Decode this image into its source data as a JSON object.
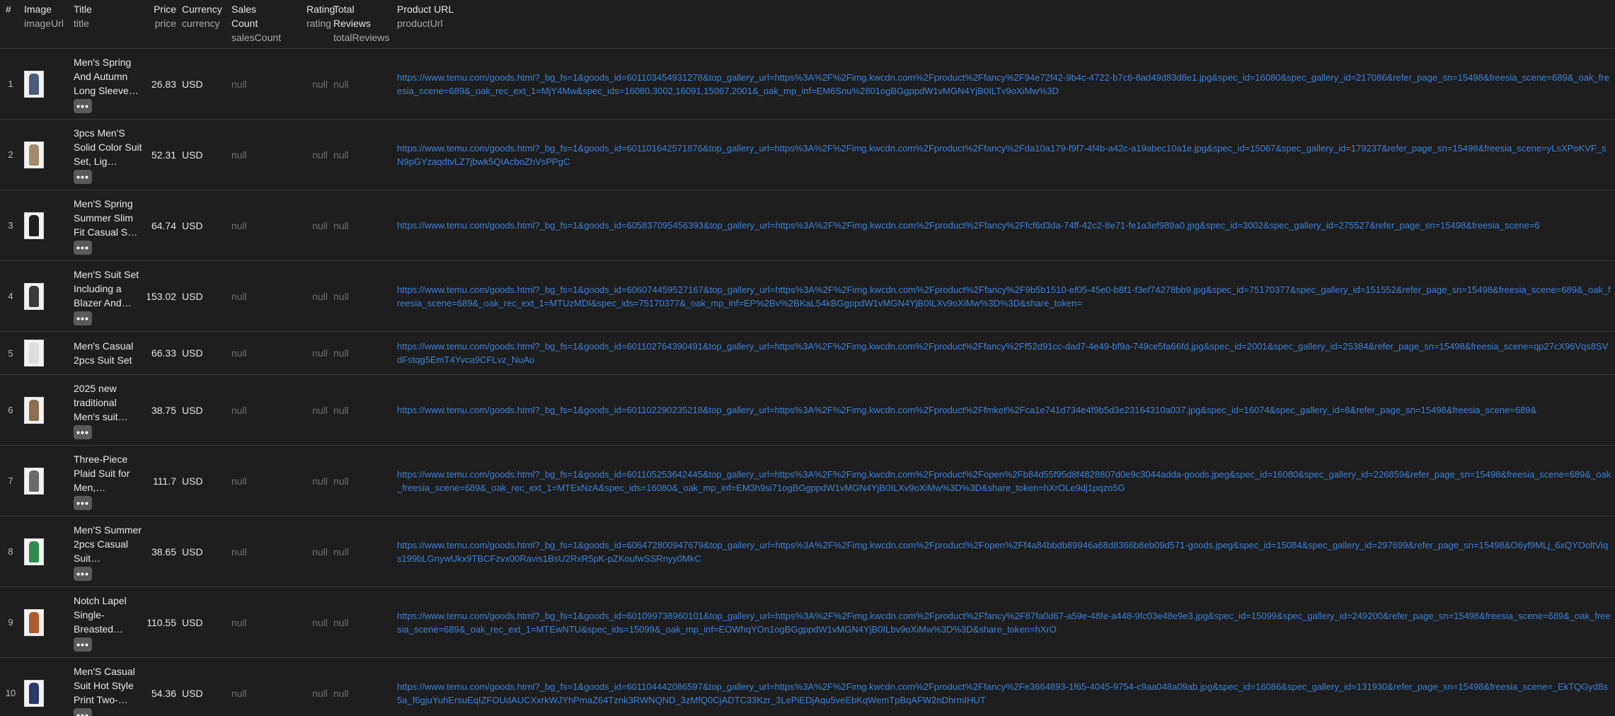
{
  "columns": [
    {
      "label": "#",
      "key": ""
    },
    {
      "label": "Image",
      "key": "imageUrl"
    },
    {
      "label": "Title",
      "key": "title"
    },
    {
      "label": "Price",
      "key": "price"
    },
    {
      "label": "Currency",
      "key": "currency"
    },
    {
      "label": "Sales Count",
      "key": "salesCount"
    },
    {
      "label": "Rating",
      "key": "rating"
    },
    {
      "label": "Total Reviews",
      "key": "totalReviews"
    },
    {
      "label": "Product URL",
      "key": "productUrl"
    }
  ],
  "more_icon": "ellipsis-icon",
  "rows": [
    {
      "n": "1",
      "title": "Men's Spring And Autumn Long Sleeve…",
      "price": "26.83",
      "currency": "USD",
      "sales": "null",
      "rating": "null",
      "reviews": "null",
      "thumb_color": "#4a5a7a",
      "url": "https://www.temu.com/goods.html?_bg_fs=1&goods_id=601103454931278&top_gallery_url=https%3A%2F%2Fimg.kwcdn.com%2Fproduct%2Ffancy%2F94e72f42-9b4c-4722-b7c6-8ad49d83d8e1.jpg&spec_id=16080&spec_gallery_id=217086&refer_page_sn=15498&freesia_scene=689&_oak_freesia_scene=689&_oak_rec_ext_1=MjY4Mw&spec_ids=16080,3002,16091,15067,2001&_oak_mp_inf=EM6Snu%2801ogBGgppdW1vMGN4YjB0ILTv9oXiMw%3D"
    },
    {
      "n": "2",
      "title": "3pcs Men'S Solid Color Suit Set, Lig…",
      "price": "52.31",
      "currency": "USD",
      "sales": "null",
      "rating": "null",
      "reviews": "null",
      "thumb_color": "#a08a6a",
      "url": "https://www.temu.com/goods.html?_bg_fs=1&goods_id=601101642571876&top_gallery_url=https%3A%2F%2Fimg.kwcdn.com%2Fproduct%2Ffancy%2Fda10a179-f9f7-4f4b-a42c-a19abec10a1e.jpg&spec_id=15067&spec_gallery_id=179237&refer_page_sn=15498&freesia_scene=yLsXPoKVF_sN9pGYzaqdtvLZ7jbwk5QIAcboZhVsPPgC"
    },
    {
      "n": "3",
      "title": "Men'S Spring Summer Slim Fit Casual S…",
      "price": "64.74",
      "currency": "USD",
      "sales": "null",
      "rating": "null",
      "reviews": "null",
      "thumb_color": "#1e1e1e",
      "url": "https://www.temu.com/goods.html?_bg_fs=1&goods_id=605837095456393&top_gallery_url=https%3A%2F%2Fimg.kwcdn.com%2Fproduct%2Ffancy%2Ffcf6d3da-74ff-42c2-8e71-fe1a3ef989a0.jpg&spec_id=3002&spec_gallery_id=275527&refer_page_sn=15498&freesia_scene=6"
    },
    {
      "n": "4",
      "title": "Men'S Suit Set Including a Blazer And…",
      "price": "153.02",
      "currency": "USD",
      "sales": "null",
      "rating": "null",
      "reviews": "null",
      "thumb_color": "#3a3a3a",
      "url": "https://www.temu.com/goods.html?_bg_fs=1&goods_id=606074459527167&top_gallery_url=https%3A%2F%2Fimg.kwcdn.com%2Fproduct%2Ffancy%2F9b5b1510-ef05-45e0-b8f1-f3ef74278bb9.jpg&spec_id=75170377&spec_gallery_id=151552&refer_page_sn=15498&freesia_scene=689&_oak_freesia_scene=689&_oak_rec_ext_1=MTUzMDI&spec_ids=75170377&_oak_mp_inf=EP%2Bv%2BKaL54kBGgppdW1vMGN4YjB0ILXv9oXiMw%3D%3D&share_token="
    },
    {
      "n": "5",
      "title": "Men's Casual 2pcs Suit Set",
      "price": "66.33",
      "currency": "USD",
      "sales": "null",
      "rating": "null",
      "reviews": "null",
      "thumb_color": "#dcdcdc",
      "url": "https://www.temu.com/goods.html?_bg_fs=1&goods_id=601102764390491&top_gallery_url=https%3A%2F%2Fimg.kwcdn.com%2Fproduct%2Ffancy%2Ff52d91cc-dad7-4e49-bf9a-749ce5fa66fd.jpg&spec_id=2001&spec_gallery_id=25384&refer_page_sn=15498&freesia_scene=qp27cX96Vqs8SVdFstqg5EmT4Yvca9CFLvz_NuAo"
    },
    {
      "n": "6",
      "title": "2025 new traditional Men's suit…",
      "price": "38.75",
      "currency": "USD",
      "sales": "null",
      "rating": "null",
      "reviews": "null",
      "thumb_color": "#8a7050",
      "url": "https://www.temu.com/goods.html?_bg_fs=1&goods_id=601102290235218&top_gallery_url=https%3A%2F%2Fimg.kwcdn.com%2Fproduct%2Ffmket%2Fca1e741d734e4f9b5d3e23164310a037.jpg&spec_id=16074&spec_gallery_id=8&refer_page_sn=15498&freesia_scene=689&"
    },
    {
      "n": "7",
      "title": "Three-Piece Plaid Suit for Men,…",
      "price": "111.7",
      "currency": "USD",
      "sales": "null",
      "rating": "null",
      "reviews": "null",
      "thumb_color": "#6a6a6a",
      "url": "https://www.temu.com/goods.html?_bg_fs=1&goods_id=601105253642445&top_gallery_url=https%3A%2F%2Fimg.kwcdn.com%2Fproduct%2Fopen%2Fb84d55f95d8f4828807d0e9c3044adda-goods.jpeg&spec_id=16080&spec_gallery_id=226859&refer_page_sn=15498&freesia_scene=689&_oak_freesia_scene=689&_oak_rec_ext_1=MTExNzA&spec_ids=16080&_oak_mp_inf=EM3h9si71ogBGgppdW1vMGN4YjB0ILXv9oXiMw%3D%3D&share_token=hXrOLe9dj1pqzo5G"
    },
    {
      "n": "8",
      "title": "Men'S Summer 2pcs Casual Suit…",
      "price": "38.65",
      "currency": "USD",
      "sales": "null",
      "rating": "null",
      "reviews": "null",
      "thumb_color": "#2e8a4a",
      "url": "https://www.temu.com/goods.html?_bg_fs=1&goods_id=606472800947679&top_gallery_url=https%3A%2F%2Fimg.kwcdn.com%2Fproduct%2Fopen%2Ff4a84bbdb89946a68d8366b8eb09d571-goods.jpeg&spec_id=15084&spec_gallery_id=297699&refer_page_sn=15498&O6yf9MLj_6xQYOoltViqs199bLGnywUkx9TBCFzvx00Ravis1BsU2RxR5pK-pZKoufwSSRnyy0MkC"
    },
    {
      "n": "9",
      "title": "Notch Lapel Single-Breasted…",
      "price": "110.55",
      "currency": "USD",
      "sales": "null",
      "rating": "null",
      "reviews": "null",
      "thumb_color": "#b05a30",
      "url": "https://www.temu.com/goods.html?_bg_fs=1&goods_id=601099738960101&top_gallery_url=https%3A%2F%2Fimg.kwcdn.com%2Fproduct%2Ffancy%2F87fa0d67-a59e-48fe-a448-9fc03e48e9e3.jpg&spec_id=15099&spec_gallery_id=249200&refer_page_sn=15498&freesia_scene=689&_oak_freesia_scene=689&_oak_rec_ext_1=MTEwNTU&spec_ids=15099&_oak_mp_inf=EOWhqYOn1ogBGgppdW1vMGN4YjB0ILbv9oXiMw%3D%3D&share_token=hXrO"
    },
    {
      "n": "10",
      "title": "Men'S Casual Suit Hot Style Print Two-…",
      "price": "54.36",
      "currency": "USD",
      "sales": "null",
      "rating": "null",
      "reviews": "null",
      "thumb_color": "#2a3a6a",
      "url": "https://www.temu.com/goods.html?_bg_fs=1&goods_id=601104442086597&top_gallery_url=https%3A%2F%2Fimg.kwcdn.com%2Fproduct%2Ffancy%2Fe3664893-1f65-4045-9754-c9aa048a09ab.jpg&spec_id=16086&spec_gallery_id=131930&refer_page_sn=15498&freesia_scene=_EkTQGyd8s5a_f6gjuYuhErsuEqIZFOUdAUCXxrkWJYhPmaZ64Tznk3RWNQND_3zMfQ0CjADTC33Kzr_3LePiEDjAqu5veEbKqWemTpBqAFW2nDhrmIHUT"
    }
  ]
}
